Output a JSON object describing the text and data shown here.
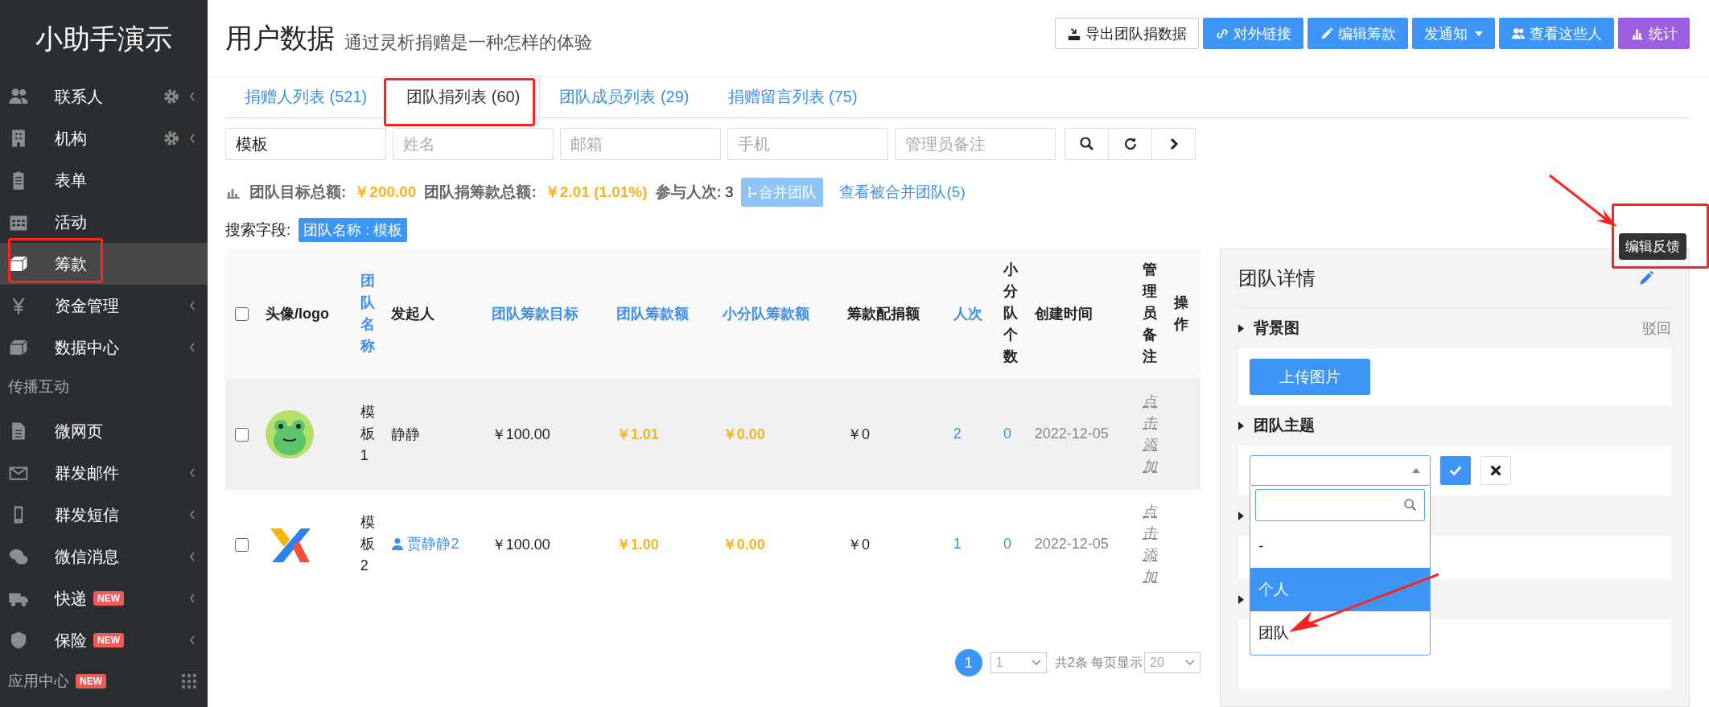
{
  "sidebar": {
    "title": "小助手演示",
    "items": [
      {
        "kind": "item",
        "label": "联系人",
        "selected": false,
        "settings": true,
        "expandable": true
      },
      {
        "kind": "item",
        "label": "机构",
        "selected": false,
        "settings": true,
        "expandable": true
      },
      {
        "kind": "item",
        "label": "表单",
        "selected": false,
        "settings": false,
        "expandable": false
      },
      {
        "kind": "item",
        "label": "活动",
        "selected": false,
        "settings": false,
        "expandable": false
      },
      {
        "kind": "item",
        "label": "筹款",
        "selected": true,
        "settings": false,
        "expandable": false
      },
      {
        "kind": "item",
        "label": "资金管理",
        "selected": false,
        "settings": false,
        "expandable": true
      },
      {
        "kind": "item",
        "label": "数据中心",
        "selected": false,
        "settings": false,
        "expandable": true
      },
      {
        "kind": "section",
        "label": "传播互动"
      },
      {
        "kind": "item",
        "label": "微网页",
        "selected": false,
        "settings": false,
        "expandable": false
      },
      {
        "kind": "item",
        "label": "群发邮件",
        "selected": false,
        "settings": false,
        "expandable": true
      },
      {
        "kind": "item",
        "label": "群发短信",
        "selected": false,
        "settings": false,
        "expandable": true
      },
      {
        "kind": "item",
        "label": "微信消息",
        "selected": false,
        "settings": false,
        "expandable": true
      },
      {
        "kind": "item",
        "label": "快递",
        "selected": false,
        "settings": false,
        "expandable": true,
        "badge": "NEW"
      },
      {
        "kind": "item",
        "label": "保险",
        "selected": false,
        "settings": false,
        "expandable": true,
        "badge": "NEW"
      }
    ],
    "footer": {
      "label": "应用中心",
      "badge": "NEW"
    }
  },
  "header": {
    "title": "用户数据",
    "subtitle": "通过灵析捐赠是一种怎样的体验",
    "buttons": [
      {
        "kind": "default",
        "label": "导出团队捐数据"
      },
      {
        "kind": "primary",
        "label": "对外链接"
      },
      {
        "kind": "primary",
        "label": "编辑筹款"
      },
      {
        "kind": "dropdown",
        "label": "发通知"
      },
      {
        "kind": "primary",
        "label": "查看这些人"
      },
      {
        "kind": "purple",
        "label": "统计"
      }
    ]
  },
  "tabs": [
    {
      "label": "捐赠人列表 (521)",
      "selected": false
    },
    {
      "label": "团队捐列表 (60)",
      "selected": true
    },
    {
      "label": "团队成员列表 (29)",
      "selected": false
    },
    {
      "label": "捐赠留言列表 (75)",
      "selected": false
    }
  ],
  "filters": [
    {
      "value": "模板"
    },
    {
      "placeholder": "姓名"
    },
    {
      "placeholder": "邮箱"
    },
    {
      "placeholder": "手机"
    },
    {
      "placeholder": "管理员备注"
    }
  ],
  "stats": {
    "goal_label": "团队目标总额:",
    "goal": "￥200.00",
    "raised_label": "团队捐筹款总额:",
    "raised": "￥2.01 (1.01%)",
    "count_label": "参与人次:",
    "count": "3",
    "merge_button": "合并团队",
    "merged_link": "查看被合并团队(5)"
  },
  "search_fields": {
    "label": "搜索字段:",
    "tag": "团队名称 : 模板"
  },
  "table": {
    "all_checked": false,
    "columns": [
      {
        "label": "头像/logo",
        "sortable": false
      },
      {
        "label": "团队名称",
        "sortable": true
      },
      {
        "label": "发起人",
        "sortable": false
      },
      {
        "label": "团队筹款目标",
        "sortable": true
      },
      {
        "label": "团队筹款额",
        "sortable": true
      },
      {
        "label": "小分队筹款额",
        "sortable": true
      },
      {
        "label": "筹款配捐额",
        "sortable": false
      },
      {
        "label": "人次",
        "sortable": true
      },
      {
        "label": "小分队个数",
        "sortable": false
      },
      {
        "label": "创建时间",
        "sortable": false
      },
      {
        "label": "管理员备注",
        "sortable": false
      },
      {
        "label": "操作",
        "sortable": false
      }
    ],
    "rows": [
      {
        "checked": false,
        "hovered": true,
        "name": "模板1",
        "sponsor": "静静",
        "sponsor_linked": false,
        "goal": "￥100.00",
        "raised": "￥1.01",
        "squad_raised": "￥0.00",
        "matched": "￥0",
        "count": "2",
        "squads": "0",
        "created": "2022-12-05",
        "note_placeholder": "点击添加"
      },
      {
        "checked": false,
        "hovered": false,
        "name": "模板2",
        "sponsor": "贾静静2",
        "sponsor_linked": true,
        "goal": "￥100.00",
        "raised": "￥1.00",
        "squad_raised": "￥0.00",
        "matched": "￥0",
        "count": "1",
        "squads": "0",
        "created": "2022-12-05",
        "note_placeholder": "点击添加"
      }
    ]
  },
  "pagination": {
    "pages": [
      {
        "label": "1",
        "selected": true
      }
    ],
    "page_select": "1",
    "summary": "共2条 每页显示",
    "page_size": "20"
  },
  "detail_panel": {
    "title": "团队详情",
    "tooltip": "编辑反馈",
    "reject_link": "驳回",
    "sections": [
      {
        "title": "背景图",
        "upload_button": "上传图片"
      },
      {
        "title": "团队主题"
      }
    ],
    "theme_options": [
      {
        "label": "-",
        "selected": false
      },
      {
        "label": "个人",
        "selected": true
      },
      {
        "label": "团队",
        "selected": false
      }
    ]
  }
}
